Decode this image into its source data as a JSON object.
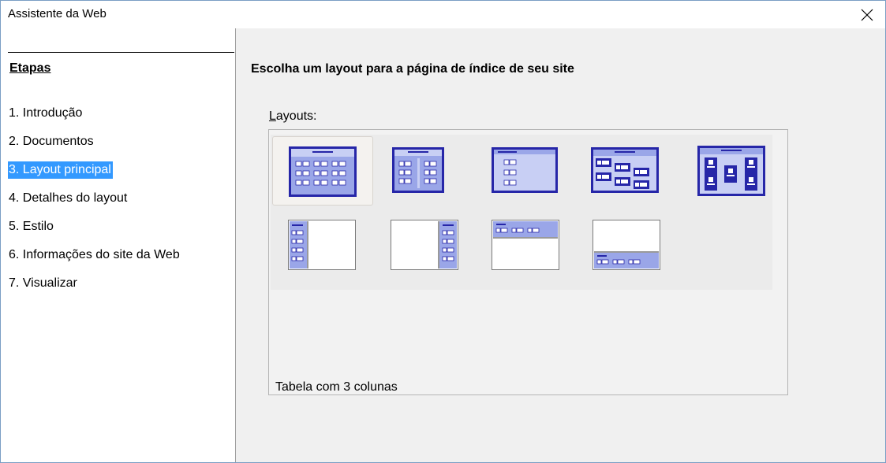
{
  "window": {
    "title": "Assistente da Web"
  },
  "sidebar": {
    "heading": "Etapas",
    "steps": [
      {
        "label": "1. Introdução",
        "active": false
      },
      {
        "label": "2. Documentos",
        "active": false
      },
      {
        "label": "3. Layout principal",
        "active": true
      },
      {
        "label": "4. Detalhes do layout",
        "active": false
      },
      {
        "label": "5. Estilo",
        "active": false
      },
      {
        "label": "6. Informações do site da Web",
        "active": false
      },
      {
        "label": "7. Visualizar",
        "active": false
      }
    ]
  },
  "main": {
    "title": "Escolha um layout para a página de índice de seu site",
    "layouts_label_mnemonic": "L",
    "layouts_label_rest": "ayouts:",
    "selected_layout": "Tabela com 3 colunas",
    "layout_options": [
      {
        "icon": "table-3-columns-icon",
        "selected": true
      },
      {
        "icon": "table-2-columns-icon",
        "selected": false
      },
      {
        "icon": "simple-list-icon",
        "selected": false
      },
      {
        "icon": "diagonal-list-icon",
        "selected": false
      },
      {
        "icon": "zigzag-icons-icon",
        "selected": false
      },
      {
        "icon": "left-frame-icon",
        "selected": false
      },
      {
        "icon": "right-frame-icon",
        "selected": false
      },
      {
        "icon": "top-frame-icon",
        "selected": false
      },
      {
        "icon": "bottom-frame-icon",
        "selected": false
      }
    ]
  },
  "colors": {
    "accent": "#3399ff",
    "icon_dark": "#2626a8",
    "icon_light": "#9aa6e8"
  }
}
